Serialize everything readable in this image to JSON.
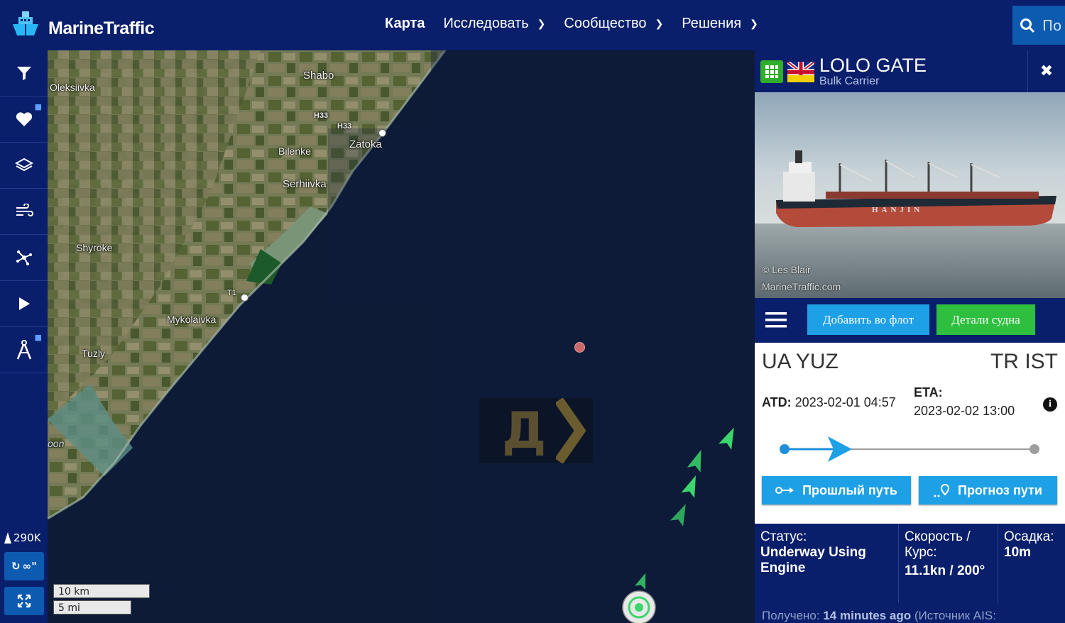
{
  "app": {
    "brand": "MarineTraffic"
  },
  "nav": {
    "items": [
      {
        "label": "Карта",
        "active": true
      },
      {
        "label": "Исследовать",
        "dropdown": true
      },
      {
        "label": "Сообщество",
        "dropdown": true
      },
      {
        "label": "Решения",
        "dropdown": true
      }
    ],
    "search_placeholder": "По"
  },
  "sidebar": {
    "items": [
      {
        "icon": "filter-icon"
      },
      {
        "icon": "heart-icon",
        "locked": true
      },
      {
        "icon": "layers-icon"
      },
      {
        "icon": "wind-icon"
      },
      {
        "icon": "density-icon"
      },
      {
        "icon": "play-icon"
      },
      {
        "icon": "compass-icon",
        "locked": true
      }
    ],
    "vessel_count": "290K",
    "refresh_label": "∞\""
  },
  "map": {
    "places": [
      "Oleksiivka",
      "Shabo",
      "H33",
      "H33",
      "Zatoka",
      "Bilenke",
      "Serhiivka",
      "Shyroke",
      "T1",
      "Mykolaivka",
      "Tuzly",
      "oon"
    ],
    "watermark_letter": "Д",
    "scale": {
      "km": "10 km",
      "mi": "5 mi"
    }
  },
  "vessel": {
    "name": "LOLO GATE",
    "type": "Bulk Carrier",
    "photo_credit_1": "© Les Blair",
    "photo_credit_2": "MarineTraffic.com",
    "hull_text": "HANJIN",
    "actions": {
      "add_fleet": "Добавить во флот",
      "details": "Детали судна"
    },
    "voyage": {
      "from_country": "UA",
      "from_port": "YUZ",
      "to_country": "TR",
      "to_port": "IST",
      "atd_label": "ATD:",
      "atd_value": "2023-02-01 04:57",
      "eta_label": "ETA:",
      "eta_value": "2023-02-02 13:00",
      "progress": 0.23
    },
    "route_buttons": {
      "past": "Прошлый путь",
      "forecast": "Прогноз пути"
    },
    "status_label": "Статус:",
    "status_value": "Underway Using Engine",
    "speed_label": "Скорость / Курс:",
    "speed_value": "11.1kn / 200°",
    "draught_label": "Осадка:",
    "draught_value": "10m",
    "received_label": "Получено:",
    "received_value": "14 minutes ago",
    "received_suffix": "(Источник AIS:"
  },
  "colors": {
    "navy": "#0a1f6b",
    "blue_button": "#1ea0e6",
    "green_button": "#2fbf3f",
    "vessel_green": "#3bd66b"
  }
}
